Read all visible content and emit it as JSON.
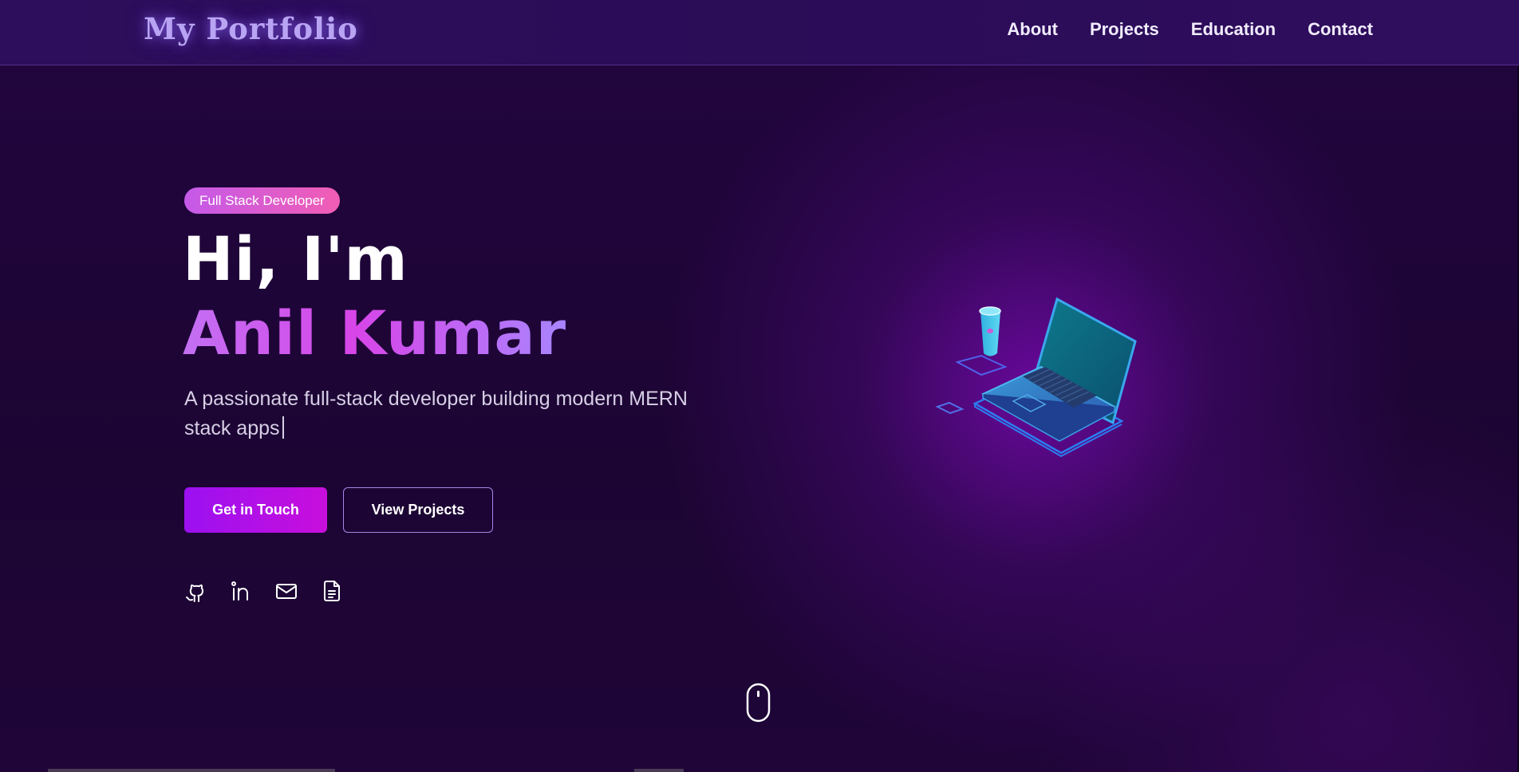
{
  "brand": "My Portfolio",
  "nav": {
    "items": [
      "About",
      "Projects",
      "Education",
      "Contact"
    ]
  },
  "hero": {
    "badge": "Full Stack Developer",
    "greeting": "Hi, I'm",
    "name": "Anil Kumar",
    "tagline": "A passionate full-stack developer building modern MERN stack apps",
    "primary_button": "Get in Touch",
    "secondary_button": "View Projects"
  },
  "socials": [
    {
      "icon": "github-icon"
    },
    {
      "icon": "linkedin-icon"
    },
    {
      "icon": "mail-icon"
    },
    {
      "icon": "document-icon"
    }
  ],
  "colors": {
    "background": "#1e0537",
    "navbar": "#2c0e5c",
    "brand_glow": "#b9a4f4",
    "badge_gradient": [
      "#c45ae9",
      "#f15db4"
    ],
    "primary_button": [
      "#9b10f0",
      "#c80fdc"
    ],
    "name_gradient": [
      "#c370f3",
      "#d745e8",
      "#a885ff"
    ]
  }
}
